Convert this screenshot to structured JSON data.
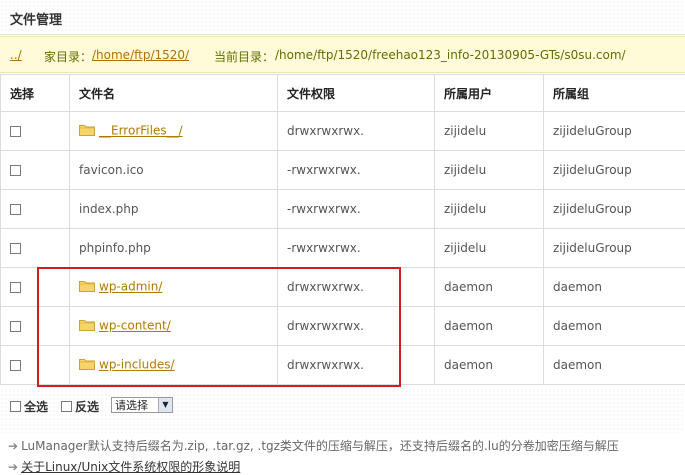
{
  "title": "文件管理",
  "path_bar": {
    "up_link": "../",
    "home_label": "家目录：",
    "home_path": "/home/ftp/1520/",
    "current_label": "当前目录：",
    "current_path": "/home/ftp/1520/freehao123_info-20130905-GTs/s0su.com/"
  },
  "table": {
    "headers": [
      "选择",
      "文件名",
      "文件权限",
      "所属用户",
      "所属组"
    ],
    "rows": [
      {
        "name": "__ErrorFiles__/",
        "is_folder": true,
        "perm": "drwxrwxrwx.",
        "user": "zijidelu",
        "group": "zijideluGroup"
      },
      {
        "name": "favicon.ico",
        "is_folder": false,
        "perm": "-rwxrwxrwx.",
        "user": "zijidelu",
        "group": "zijideluGroup"
      },
      {
        "name": "index.php",
        "is_folder": false,
        "perm": "-rwxrwxrwx.",
        "user": "zijidelu",
        "group": "zijideluGroup"
      },
      {
        "name": "phpinfo.php",
        "is_folder": false,
        "perm": "-rwxrwxrwx.",
        "user": "zijidelu",
        "group": "zijideluGroup"
      },
      {
        "name": "wp-admin/",
        "is_folder": true,
        "perm": "drwxrwxrwx.",
        "user": "daemon",
        "group": "daemon"
      },
      {
        "name": "wp-content/",
        "is_folder": true,
        "perm": "drwxrwxrwx.",
        "user": "daemon",
        "group": "daemon"
      },
      {
        "name": "wp-includes/",
        "is_folder": true,
        "perm": "drwxrwxrwx.",
        "user": "daemon",
        "group": "daemon"
      }
    ]
  },
  "bulk": {
    "select_all": "全选",
    "invert": "反选",
    "action_select": "请选择"
  },
  "notes": {
    "line1": "LuManager默认支持后缀名为.zip, .tar.gz, .tgz类文件的压缩与解压，还支持后缀名的.lu的分卷加密压缩与解压",
    "line2": "关于Linux/Unix文件系统权限的形象说明"
  },
  "colors": {
    "highlight": "#d01e1e",
    "path_bg": "#fffbd8",
    "link": "#b07a00"
  }
}
